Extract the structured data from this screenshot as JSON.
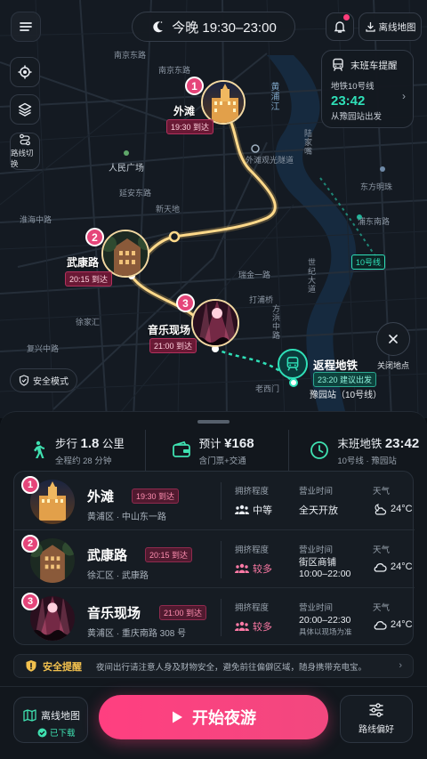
{
  "header": {
    "tonight_label": "今晚 19:30–23:00",
    "offline_map_label": "离线地图",
    "has_notification": true
  },
  "map": {
    "route_switch_label": "路线切换",
    "safe_mode_label": "安全模式",
    "close_spots_label": "关闭地点",
    "line_badge": "10号线",
    "street_labels": {
      "nanjing_east": "南京东路",
      "nanjing_east_2": "南京东路",
      "huangpu_river": "黄浦江",
      "bund_tunnel": "外滩观光隧道",
      "lujiazui": "陆家嘴",
      "dongfang_mingzhu": "东方明珠",
      "peoples_square": "人民广场",
      "yanan_east": "延安东路",
      "huaihai": "淮海中路",
      "xintiandi": "新天地",
      "pudong_south": "浦东南路",
      "shiji": "世纪大道",
      "dapu": "打浦桥",
      "xujiahui": "徐家汇",
      "ruijin": "瑞金一路",
      "laoximen": "老西门",
      "fuxing": "复兴中路",
      "fangbang": "方浜中路"
    },
    "markers": [
      {
        "num": "1",
        "name": "外滩",
        "tag": "19:30 到达"
      },
      {
        "num": "2",
        "name": "武康路",
        "tag": "20:15 到达"
      },
      {
        "num": "3",
        "name": "音乐现场",
        "tag": "21:00 到达"
      }
    ],
    "metro_end": {
      "title": "返程地铁",
      "tag": "23:20 建议出发",
      "station": "豫园站（10号线）"
    }
  },
  "last_train_card": {
    "title": "末班车提醒",
    "line": "地铁10号线",
    "time": "23:42",
    "from": "从豫园站出发"
  },
  "summary": {
    "walk": {
      "label": "步行",
      "value": "1.8",
      "unit": "公里",
      "sub": "全程约 28 分钟"
    },
    "budget": {
      "label": "预计",
      "value": "¥168",
      "sub": "含门票+交通"
    },
    "last_metro": {
      "label": "末班地铁",
      "value": "23:42",
      "sub": "10号线 · 豫园站"
    }
  },
  "spots": [
    {
      "num": "1",
      "name": "外滩",
      "tag": "19:30 到达",
      "addr": "黄浦区 · 中山东一路",
      "crowd_label": "拥挤程度",
      "crowd": "中等",
      "hours_label": "营业时间",
      "hours": "全天开放",
      "hours_sub": "",
      "weather_label": "天气",
      "temp": "24°C",
      "weather_icon": "partly-cloudy-night"
    },
    {
      "num": "2",
      "name": "武康路",
      "tag": "20:15 到达",
      "addr": "徐汇区 · 武康路",
      "crowd_label": "拥挤程度",
      "crowd": "较多",
      "hours_label": "营业时间",
      "hours": "街区商铺",
      "hours_sub": "10:00–22:00",
      "weather_label": "天气",
      "temp": "24°C",
      "weather_icon": "cloud"
    },
    {
      "num": "3",
      "name": "音乐现场",
      "tag": "21:00 到达",
      "addr": "黄浦区 · 重庆南路 308 号",
      "crowd_label": "拥挤程度",
      "crowd": "较多",
      "hours_label": "营业时间",
      "hours": "20:00–22:30",
      "hours_sub": "具体以现场为准",
      "weather_label": "天气",
      "temp": "24°C",
      "weather_icon": "cloud"
    }
  ],
  "safety": {
    "title": "安全提醒",
    "text": "夜间出行请注意人身及财物安全，避免前往偏僻区域，随身携带充电宝。"
  },
  "bottom": {
    "offline_map": "离线地图",
    "downloaded": "已下载",
    "start": "开始夜游",
    "route_pref": "路线偏好"
  },
  "colors": {
    "accent_pink": "#ff3f80",
    "accent_teal": "#2fe0b8",
    "route_gold": "#f5c76a"
  }
}
